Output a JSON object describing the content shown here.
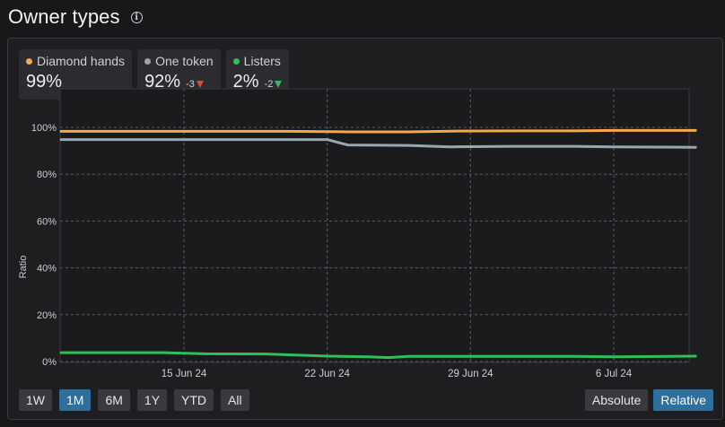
{
  "header": {
    "title": "Owner types",
    "info_icon": "info-icon"
  },
  "legend": [
    {
      "name": "Diamond hands",
      "value": "99%",
      "delta": "",
      "delta_dir": "",
      "color": "#f5a94a"
    },
    {
      "name": "One token",
      "value": "92%",
      "delta": "-3",
      "delta_dir": "down-red",
      "color": "#9aa7b1"
    },
    {
      "name": "Listers",
      "value": "2%",
      "delta": "-2",
      "delta_dir": "down-green",
      "color": "#2fbf5a"
    }
  ],
  "controls": {
    "ranges": [
      "1W",
      "1M",
      "6M",
      "1Y",
      "YTD",
      "All"
    ],
    "active_range": "1M",
    "modes": [
      "Absolute",
      "Relative"
    ],
    "active_mode": "Relative"
  },
  "chart_data": {
    "type": "line",
    "ylabel": "Ratio",
    "ylim": [
      0,
      100
    ],
    "yticks": [
      "0%",
      "20%",
      "40%",
      "60%",
      "80%",
      "100%"
    ],
    "x_start": "2024-06-08",
    "x_end": "2024-07-11",
    "x_ticks": [
      {
        "label": "15 Jun 24",
        "date": "2024-06-15"
      },
      {
        "label": "22 Jun 24",
        "date": "2024-06-22"
      },
      {
        "label": "29 Jun 24",
        "date": "2024-06-29"
      },
      {
        "label": "6 Jul 24",
        "date": "2024-07-06"
      }
    ],
    "grid": true,
    "series": [
      {
        "name": "Diamond hands",
        "color": "#f5a94a",
        "points": [
          {
            "date": "2024-06-09",
            "value": 98.3
          },
          {
            "date": "2024-06-14",
            "value": 98.3
          },
          {
            "date": "2024-06-20",
            "value": 98.3
          },
          {
            "date": "2024-06-22",
            "value": 98.2
          },
          {
            "date": "2024-06-23",
            "value": 98.1
          },
          {
            "date": "2024-06-26",
            "value": 98.1
          },
          {
            "date": "2024-06-28",
            "value": 98.4
          },
          {
            "date": "2024-07-01",
            "value": 98.5
          },
          {
            "date": "2024-07-04",
            "value": 98.5
          },
          {
            "date": "2024-07-06",
            "value": 98.7
          },
          {
            "date": "2024-07-10",
            "value": 98.7
          }
        ]
      },
      {
        "name": "One token",
        "color": "#9aa7b1",
        "points": [
          {
            "date": "2024-06-09",
            "value": 94.8
          },
          {
            "date": "2024-06-14",
            "value": 94.8
          },
          {
            "date": "2024-06-20",
            "value": 94.8
          },
          {
            "date": "2024-06-22",
            "value": 94.8
          },
          {
            "date": "2024-06-23",
            "value": 92.5
          },
          {
            "date": "2024-06-26",
            "value": 92.3
          },
          {
            "date": "2024-06-28",
            "value": 91.7
          },
          {
            "date": "2024-07-01",
            "value": 91.9
          },
          {
            "date": "2024-07-04",
            "value": 91.9
          },
          {
            "date": "2024-07-06",
            "value": 91.7
          },
          {
            "date": "2024-07-10",
            "value": 91.5
          }
        ]
      },
      {
        "name": "Listers",
        "color": "#2fbf5a",
        "points": [
          {
            "date": "2024-06-09",
            "value": 3.8
          },
          {
            "date": "2024-06-14",
            "value": 3.8
          },
          {
            "date": "2024-06-16",
            "value": 3.3
          },
          {
            "date": "2024-06-19",
            "value": 3.2
          },
          {
            "date": "2024-06-22",
            "value": 2.3
          },
          {
            "date": "2024-06-24",
            "value": 2.0
          },
          {
            "date": "2024-06-25",
            "value": 1.7
          },
          {
            "date": "2024-06-26",
            "value": 2.2
          },
          {
            "date": "2024-06-29",
            "value": 2.2
          },
          {
            "date": "2024-07-04",
            "value": 2.2
          },
          {
            "date": "2024-07-06",
            "value": 2.0
          },
          {
            "date": "2024-07-10",
            "value": 2.3
          }
        ]
      }
    ]
  }
}
